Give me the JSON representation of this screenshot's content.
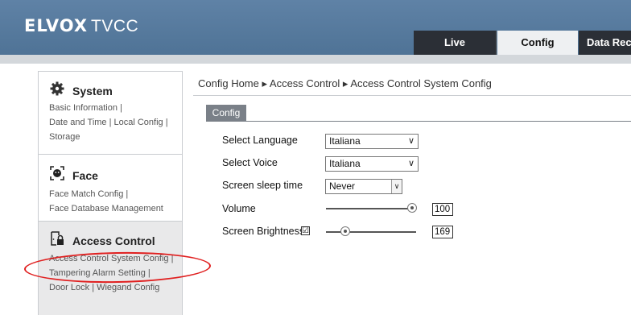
{
  "header": {
    "logo_brand": "ELVOX",
    "logo_suffix": "TVCC",
    "tabs": [
      {
        "label": "Live"
      },
      {
        "label": "Config"
      },
      {
        "label": "Data Rec"
      }
    ]
  },
  "sidebar": {
    "system": {
      "title": "System",
      "links": [
        "Basic Information |",
        "Date and Time | Local Config |",
        "Storage"
      ]
    },
    "face": {
      "title": "Face",
      "links": [
        "Face Match Config |",
        "Face Database Management"
      ]
    },
    "access": {
      "title": "Access Control",
      "links": [
        "Access Control System Config |",
        "Tampering Alarm Setting |",
        "Door Lock | Wiegand Config"
      ]
    }
  },
  "main": {
    "breadcrumb": "Config Home ▸ Access Control ▸ Access Control System Config",
    "config_tab": "Config",
    "form": {
      "language_label": "Select Language",
      "language_value": "Italiana",
      "voice_label": "Select Voice",
      "voice_value": "Italiana",
      "sleep_label": "Screen sleep time",
      "sleep_value": "Never",
      "volume_label": "Volume",
      "volume_value": "100",
      "brightness_label": "Screen Brightness",
      "brightness_checked": "☑",
      "brightness_value": "169"
    }
  },
  "colors": {
    "header": "#5a7da1",
    "tab_dark": "#2b2f36",
    "tab_active": "#eef0f2",
    "annotation": "#e02020"
  },
  "icons": {
    "system": "gear-icon",
    "face": "face-scan-icon",
    "access": "door-lock-icon"
  }
}
